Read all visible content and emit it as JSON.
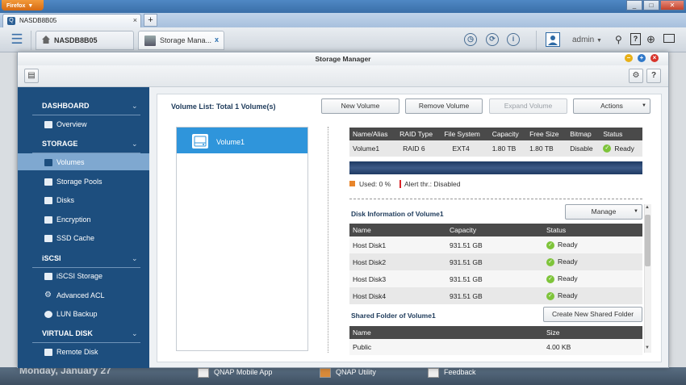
{
  "browser": {
    "menu_label": "Firefox",
    "tab_title": "NASDB8B05",
    "new_tab": "+",
    "tab_close": "×",
    "window_controls": [
      "_",
      "□",
      "✕"
    ]
  },
  "qts_bar": {
    "host_tab": "NASDB8B05",
    "app_tab": "Storage Mana...",
    "app_tab_close": "x",
    "user": "admin",
    "icons": [
      "clock-icon",
      "sync-icon",
      "info-icon",
      "user-avatar-icon",
      "search-icon",
      "help-icon",
      "globe-icon",
      "monitor-icon"
    ]
  },
  "window": {
    "title": "Storage Manager"
  },
  "sidebar": {
    "sections": [
      {
        "title": "DASHBOARD",
        "items": [
          "Overview"
        ]
      },
      {
        "title": "STORAGE",
        "items": [
          "Volumes",
          "Storage Pools",
          "Disks",
          "Encryption",
          "SSD Cache"
        ]
      },
      {
        "title": "iSCSI",
        "items": [
          "iSCSI Storage",
          "Advanced ACL",
          "LUN Backup"
        ]
      },
      {
        "title": "VIRTUAL DISK",
        "items": [
          "Remote Disk"
        ]
      }
    ],
    "selected": "Volumes"
  },
  "volume_list": {
    "title": "Volume List: Total 1 Volume(s)",
    "buttons": {
      "new": "New Volume",
      "remove": "Remove Volume",
      "expand": "Expand Volume",
      "actions": "Actions"
    },
    "items": [
      "Volume1"
    ]
  },
  "volume_table": {
    "headers": [
      "Name/Alias",
      "RAID Type",
      "File System",
      "Capacity",
      "Free Size",
      "Bitmap",
      "Status"
    ],
    "rows": [
      [
        "Volume1",
        "RAID 6",
        "EXT4",
        "1.80 TB",
        "1.80 TB",
        "Disable",
        "Ready"
      ]
    ]
  },
  "usage": {
    "used_label": "Used: 0 %",
    "alert_label": "Alert thr.: Disabled",
    "used_fraction": 0.0,
    "colors": {
      "used": "#e8852b",
      "alert": "#d9252a"
    }
  },
  "disk_info": {
    "title": "Disk Information of Volume1",
    "manage_button": "Manage",
    "headers": [
      "Name",
      "Capacity",
      "Status"
    ],
    "rows": [
      [
        "Host Disk1",
        "931.51 GB",
        "Ready"
      ],
      [
        "Host Disk2",
        "931.51 GB",
        "Ready"
      ],
      [
        "Host Disk3",
        "931.51 GB",
        "Ready"
      ],
      [
        "Host Disk4",
        "931.51 GB",
        "Ready"
      ]
    ]
  },
  "shared_folders": {
    "title": "Shared Folder of Volume1",
    "create_button": "Create New Shared Folder",
    "headers": [
      "Name",
      "Size"
    ],
    "rows": [
      [
        "Public",
        "4.00 KB"
      ]
    ]
  },
  "desktop": {
    "date_text": "Monday, January 27",
    "dock": [
      "QNAP Mobile App",
      "QNAP Utility",
      "Feedback"
    ]
  }
}
